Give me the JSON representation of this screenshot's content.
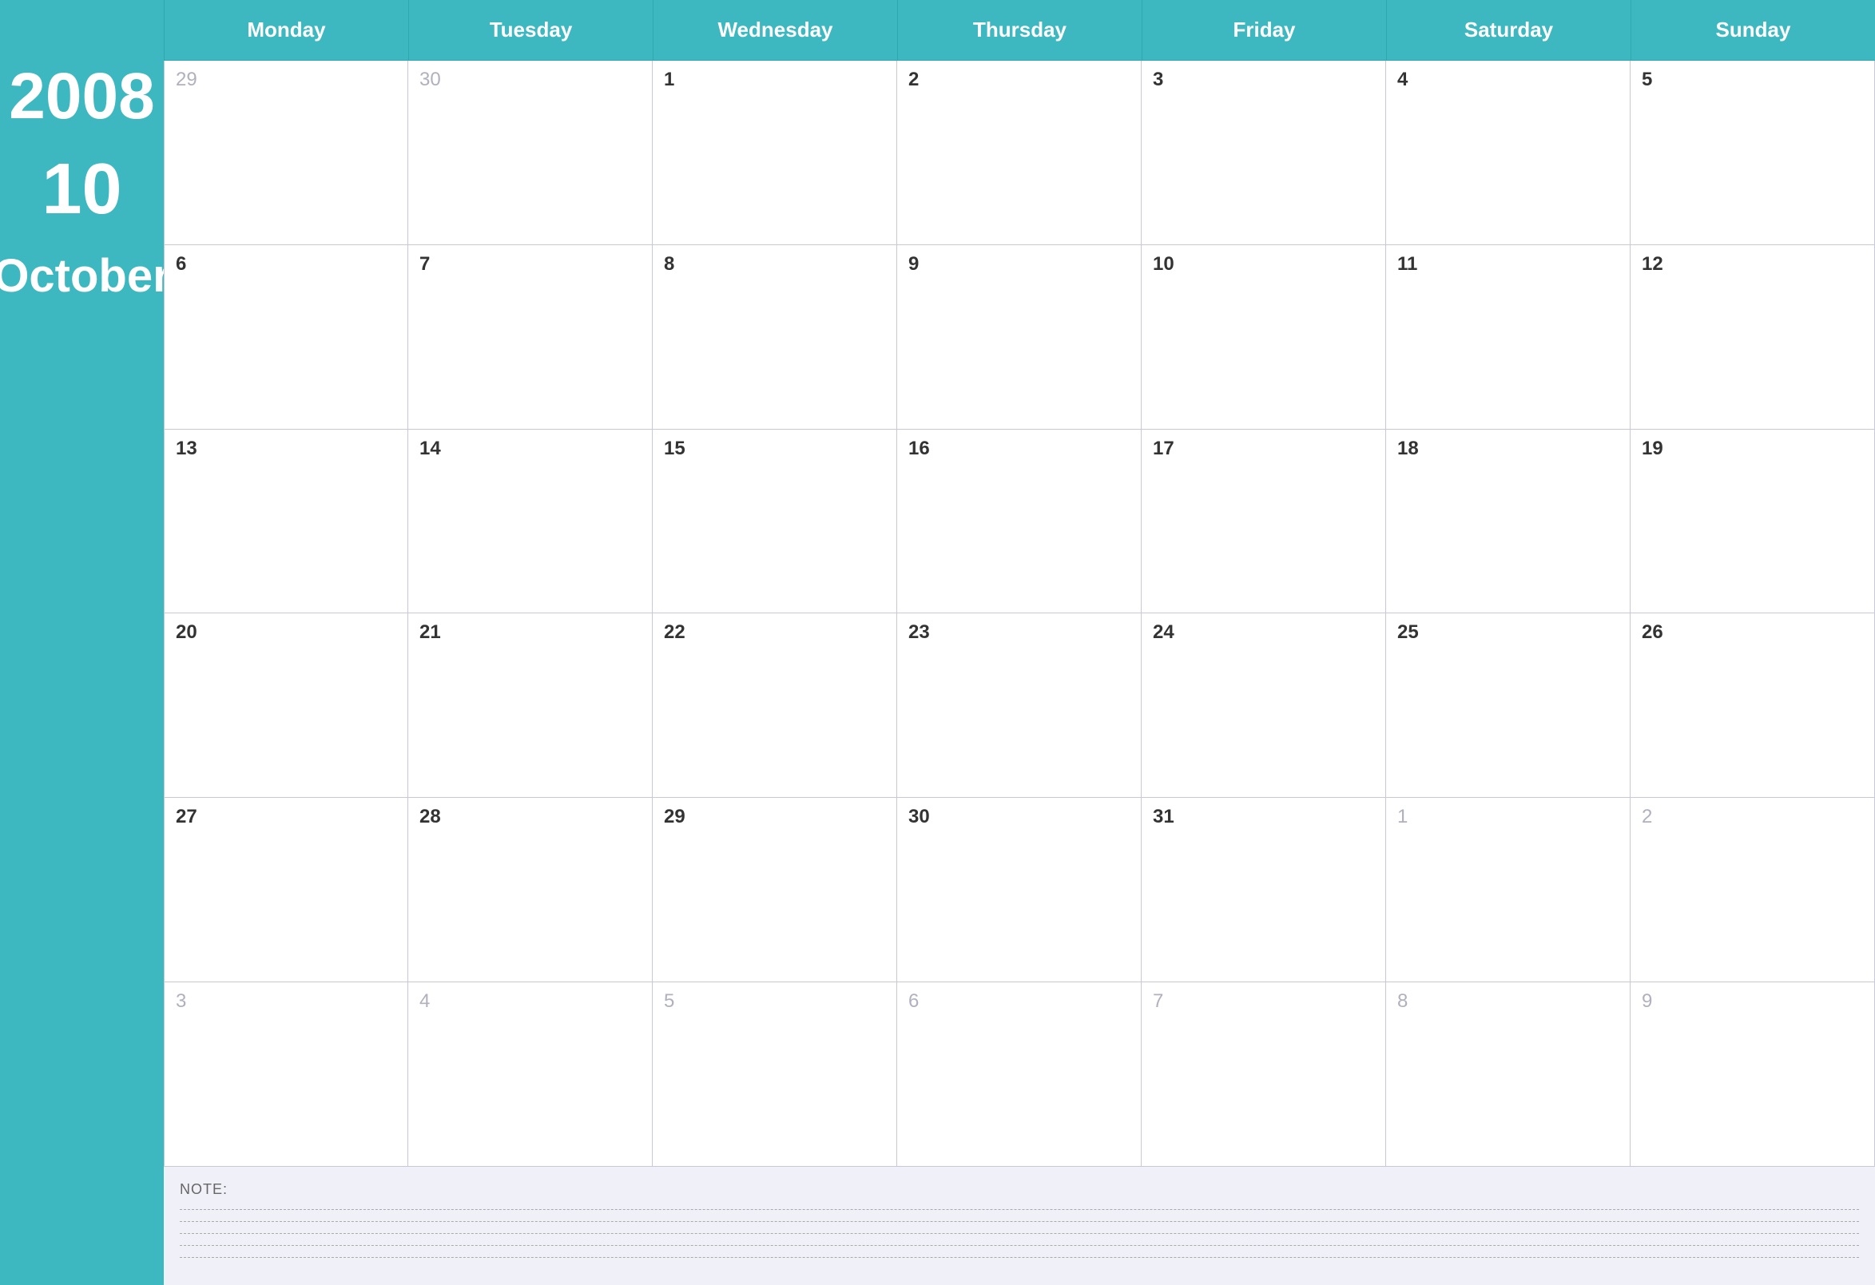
{
  "calendar": {
    "year": "2008",
    "month_number": "10",
    "month_name": "October",
    "day_headers": [
      "Monday",
      "Tuesday",
      "Wednesday",
      "Thursday",
      "Friday",
      "Saturday",
      "Sunday"
    ],
    "weeks": [
      [
        {
          "number": "29",
          "outside": true
        },
        {
          "number": "30",
          "outside": true
        },
        {
          "number": "1",
          "outside": false
        },
        {
          "number": "2",
          "outside": false
        },
        {
          "number": "3",
          "outside": false
        },
        {
          "number": "4",
          "outside": false
        },
        {
          "number": "5",
          "outside": false
        }
      ],
      [
        {
          "number": "6",
          "outside": false
        },
        {
          "number": "7",
          "outside": false
        },
        {
          "number": "8",
          "outside": false
        },
        {
          "number": "9",
          "outside": false
        },
        {
          "number": "10",
          "outside": false
        },
        {
          "number": "11",
          "outside": false
        },
        {
          "number": "12",
          "outside": false
        }
      ],
      [
        {
          "number": "13",
          "outside": false
        },
        {
          "number": "14",
          "outside": false
        },
        {
          "number": "15",
          "outside": false
        },
        {
          "number": "16",
          "outside": false
        },
        {
          "number": "17",
          "outside": false
        },
        {
          "number": "18",
          "outside": false
        },
        {
          "number": "19",
          "outside": false
        }
      ],
      [
        {
          "number": "20",
          "outside": false
        },
        {
          "number": "21",
          "outside": false
        },
        {
          "number": "22",
          "outside": false
        },
        {
          "number": "23",
          "outside": false
        },
        {
          "number": "24",
          "outside": false
        },
        {
          "number": "25",
          "outside": false
        },
        {
          "number": "26",
          "outside": false
        }
      ],
      [
        {
          "number": "27",
          "outside": false
        },
        {
          "number": "28",
          "outside": false
        },
        {
          "number": "29",
          "outside": false
        },
        {
          "number": "30",
          "outside": false
        },
        {
          "number": "31",
          "outside": false
        },
        {
          "number": "1",
          "outside": true
        },
        {
          "number": "2",
          "outside": true
        }
      ],
      [
        {
          "number": "3",
          "outside": true
        },
        {
          "number": "4",
          "outside": true
        },
        {
          "number": "5",
          "outside": true
        },
        {
          "number": "6",
          "outside": true
        },
        {
          "number": "7",
          "outside": true
        },
        {
          "number": "8",
          "outside": true
        },
        {
          "number": "9",
          "outside": true
        }
      ]
    ],
    "notes_label": "NOTE:",
    "note_lines": 5
  }
}
